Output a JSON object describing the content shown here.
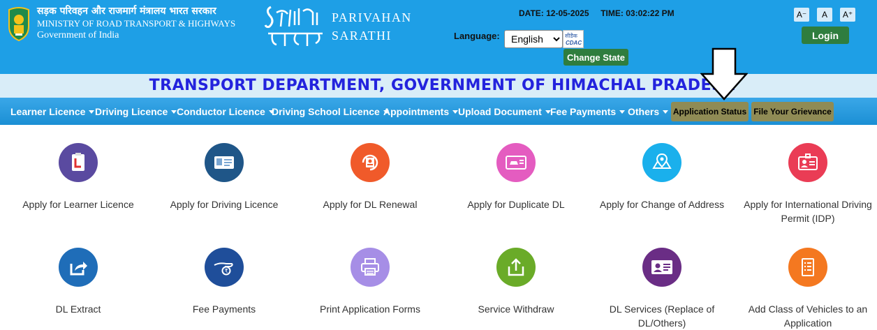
{
  "header": {
    "ministry_hindi": "सड़क परिवहन और राजमार्ग मंत्रालय भारत सरकार",
    "ministry_english": "MINISTRY OF ROAD TRANSPORT & HIGHWAYS",
    "government": "Government of India",
    "brand_line1": "PARIVAHAN",
    "brand_line2": "SARATHI",
    "date_label": "DATE:",
    "date_value": "12-05-2025",
    "time_label": "TIME:",
    "time_value": "03:02:22 PM",
    "language_label": "Language:",
    "language_selected": "English",
    "cdac_hindi": "सीडैक",
    "cdac_english": "CDAC",
    "change_state": "Change State",
    "font_decrease": "A⁻",
    "font_normal": "A",
    "font_increase": "A⁺",
    "login": "Login"
  },
  "title": "TRANSPORT DEPARTMENT, GOVERNMENT OF HIMACHAL PRADESH",
  "nav": {
    "items": [
      "Learner Licence",
      "Driving Licence",
      "Conductor Licence",
      "Driving School Licence",
      "Appointments",
      "Upload Document",
      "Fee Payments",
      "Others"
    ],
    "application_status": "Application Status",
    "file_grievance": "File Your Grievance"
  },
  "services": [
    {
      "label": "Apply for Learner Licence",
      "color": "#5a4aa0",
      "icon": "learner-licence-icon"
    },
    {
      "label": "Apply for Driving Licence",
      "color": "#1f5688",
      "icon": "driving-licence-icon"
    },
    {
      "label": "Apply for DL Renewal",
      "color": "#f05a2a",
      "icon": "dl-renewal-icon"
    },
    {
      "label": "Apply for Duplicate DL",
      "color": "#e45cc0",
      "icon": "duplicate-dl-icon"
    },
    {
      "label": "Apply for Change of Address",
      "color": "#1ab0ec",
      "icon": "change-address-icon"
    },
    {
      "label": "Apply for International Driving Permit (IDP)",
      "color": "#ea3c55",
      "icon": "idp-icon"
    },
    {
      "label": "DL Extract",
      "color": "#1f6db8",
      "icon": "dl-extract-icon"
    },
    {
      "label": "Fee Payments",
      "color": "#1f4e9a",
      "icon": "fee-payments-icon"
    },
    {
      "label": "Print Application Forms",
      "color": "#a68ee6",
      "icon": "printer-icon"
    },
    {
      "label": "Service Withdraw",
      "color": "#6aab28",
      "icon": "service-withdraw-icon"
    },
    {
      "label": "DL Services (Replace of DL/Others)",
      "color": "#6a2d85",
      "icon": "dl-services-icon"
    },
    {
      "label": "Add Class of Vehicles to an Application",
      "color": "#f47820",
      "icon": "add-class-vehicle-icon"
    }
  ]
}
